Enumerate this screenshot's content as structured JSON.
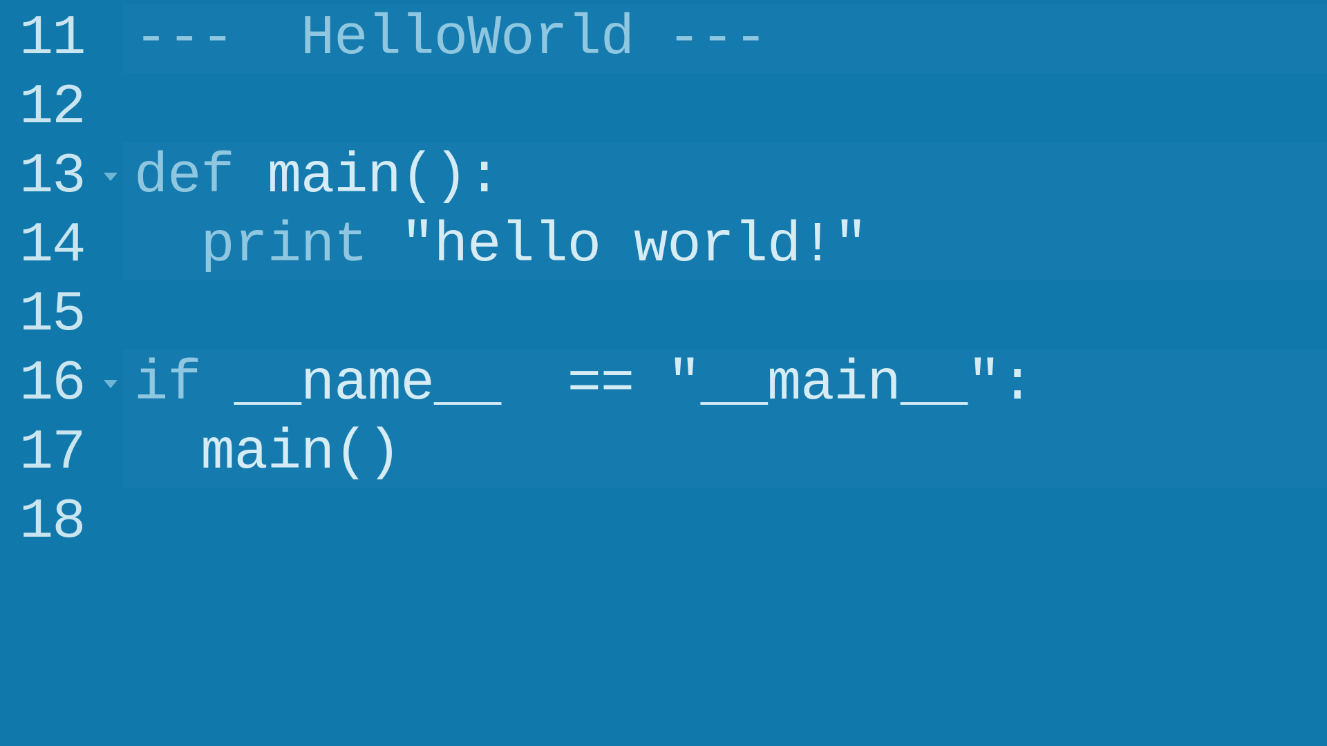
{
  "lines": [
    {
      "number": "11",
      "foldable": false,
      "tokens": [
        {
          "cls": "tok-comment",
          "text": "---  HelloWorld ---"
        }
      ]
    },
    {
      "number": "12",
      "foldable": false,
      "tokens": []
    },
    {
      "number": "13",
      "foldable": true,
      "tokens": [
        {
          "cls": "tok-keyword",
          "text": "def"
        },
        {
          "cls": "tok-default",
          "text": " "
        },
        {
          "cls": "tok-name",
          "text": "main():"
        }
      ]
    },
    {
      "number": "14",
      "foldable": false,
      "tokens": [
        {
          "cls": "tok-default",
          "text": "  "
        },
        {
          "cls": "tok-builtin",
          "text": "print"
        },
        {
          "cls": "tok-default",
          "text": " "
        },
        {
          "cls": "tok-string",
          "text": "\"hello world!\""
        }
      ]
    },
    {
      "number": "15",
      "foldable": false,
      "tokens": []
    },
    {
      "number": "16",
      "foldable": true,
      "tokens": [
        {
          "cls": "tok-keyword",
          "text": "if"
        },
        {
          "cls": "tok-default",
          "text": " __name__ "
        },
        {
          "cls": "tok-default",
          "text": " == "
        },
        {
          "cls": "tok-string",
          "text": "\"__main__\":"
        }
      ]
    },
    {
      "number": "17",
      "foldable": false,
      "tokens": [
        {
          "cls": "tok-default",
          "text": "  main()"
        }
      ]
    },
    {
      "number": "18",
      "foldable": false,
      "tokens": []
    }
  ]
}
